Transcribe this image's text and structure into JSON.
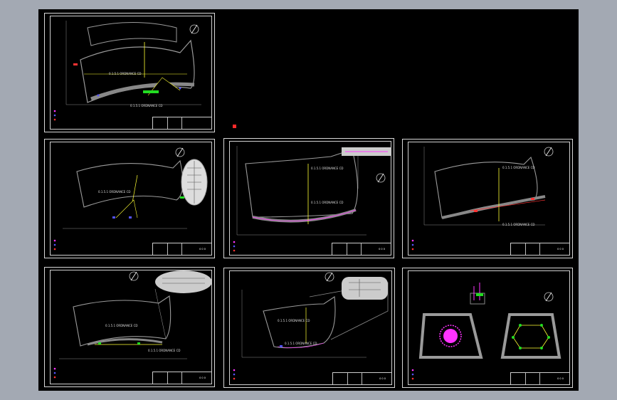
{
  "window": {
    "background": "#a3a9b3",
    "canvas_color": "#000000"
  },
  "sheets": [
    {
      "id": "sheet-1",
      "labels": [
        "0.1.5.1 ORDNANCE CD",
        "0.1.5.1 ORDNANCE CD"
      ],
      "title_block": ""
    },
    {
      "id": "sheet-2",
      "labels": [
        "0.1.5.1 ORDNANCE CD"
      ],
      "title_block": "0 0 0"
    },
    {
      "id": "sheet-3",
      "labels": [
        "0.1.5.1 ORDNANCE CD",
        "0.1.5.1 ORDNANCE CD"
      ],
      "title_block": "0 0 0"
    },
    {
      "id": "sheet-4",
      "labels": [
        "0.1.5.1 ORDNANCE CD",
        "0.1.5.1 ORDNANCE CD"
      ],
      "title_block": "0 0 0"
    },
    {
      "id": "sheet-5",
      "labels": [
        "0.1.5.1 ORDNANCE CD",
        "0.1.5.1 ORDNANCE CD"
      ],
      "title_block": "0 0 0"
    },
    {
      "id": "sheet-6",
      "labels": [
        "0.1.5.1 ORDNANCE CD",
        "0.1.5.1 ORDNANCE CD"
      ],
      "title_block": "0 0 0"
    },
    {
      "id": "sheet-7",
      "labels": [],
      "title_block": "0 0 0"
    }
  ],
  "colors": {
    "wall": "#9a9a9a",
    "route_yellow": "#ffff33",
    "device_green": "#22dd22",
    "device_red": "#ff3333",
    "device_magenta": "#ff33ff",
    "device_blue": "#5555ff"
  },
  "icons": [
    "north-arrow-icon",
    "red-marker-icon"
  ]
}
